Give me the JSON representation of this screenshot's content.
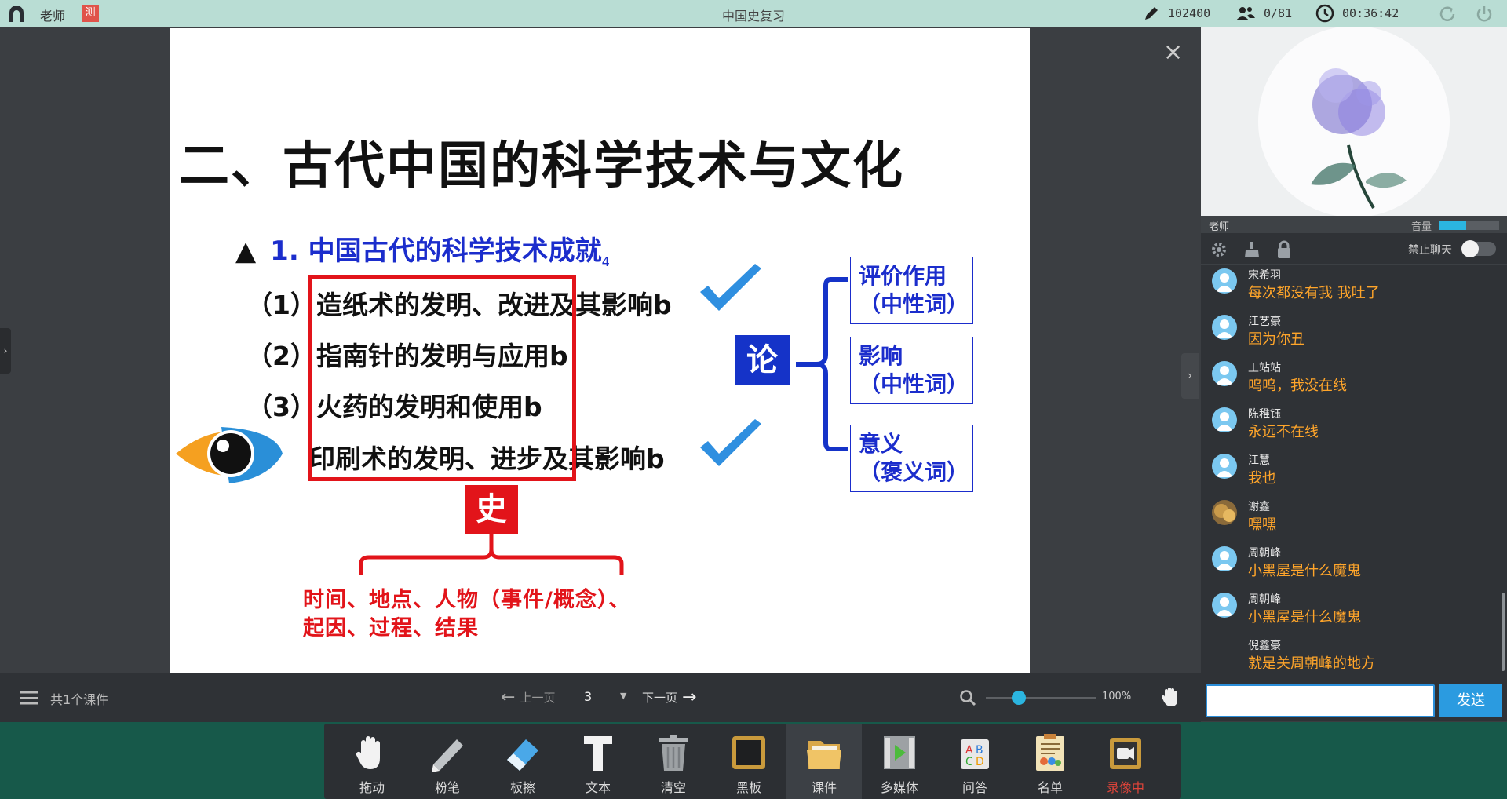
{
  "topbar": {
    "role": "老师",
    "badge": "测",
    "title": "中国史复习",
    "points": "102400",
    "online": "0/81",
    "timer": "00:36:42"
  },
  "slide": {
    "title": "二、古代中国的科学技术与文化",
    "subtitle_marker": "▲",
    "subtitle": "1. 中国古代的科学技术成就",
    "subtitle_mark": "4",
    "items": [
      "（1）造纸术的发明、改进及其影响b",
      "（2）指南针的发明与应用b",
      "（3）火药的发明和使用b",
      "印刷术的发明、进步及其影响b"
    ],
    "shi": "史",
    "shi_text_line1": "时间、地点、人物（事件/概念）、",
    "shi_text_line2": "起因、过程、结果",
    "lun": "论",
    "boxes": [
      {
        "line1": "评价作用",
        "line2": "（中性词）"
      },
      {
        "line1": "影响",
        "line2": "（中性词）"
      },
      {
        "line1": "意义",
        "line2": "（褒义词）"
      }
    ]
  },
  "video": {
    "name": "老师",
    "volume_label": "音量",
    "volume_level": 0.45
  },
  "chat": {
    "mute_label": "禁止聊天",
    "mute_on": false,
    "messages": [
      {
        "name": "宋希羽",
        "text": "每次都没有我  我吐了",
        "avatar": "default"
      },
      {
        "name": "江艺豪",
        "text": "因为你丑",
        "avatar": "default"
      },
      {
        "name": "王站站",
        "text": "呜呜，我没在线",
        "avatar": "default"
      },
      {
        "name": "陈稚钰",
        "text": "永远不在线",
        "avatar": "default"
      },
      {
        "name": "江慧",
        "text": "我也",
        "avatar": "default"
      },
      {
        "name": "谢鑫",
        "text": "嘿嘿",
        "avatar": "photo"
      },
      {
        "name": "周朝峰",
        "text": "小黑屋是什么魔鬼",
        "avatar": "default"
      },
      {
        "name": "周朝峰",
        "text": "小黑屋是什么魔鬼",
        "avatar": "default"
      },
      {
        "name": "倪鑫豪",
        "text": "就是关周朝峰的地方",
        "avatar": "none"
      }
    ],
    "input_value": "",
    "send_label": "发送"
  },
  "nav": {
    "courseware_count": "共1个课件",
    "prev_label": "上一页",
    "page": "3",
    "next_label": "下一页",
    "zoom": "100%",
    "zoom_level": 0.3
  },
  "toolbar": [
    {
      "label": "拖动",
      "icon": "hand-icon"
    },
    {
      "label": "粉笔",
      "icon": "chalk-icon"
    },
    {
      "label": "板擦",
      "icon": "eraser-icon"
    },
    {
      "label": "文本",
      "icon": "text-icon"
    },
    {
      "label": "清空",
      "icon": "trash-icon"
    },
    {
      "label": "黑板",
      "icon": "blackboard-icon"
    },
    {
      "label": "课件",
      "icon": "folder-icon",
      "active": true
    },
    {
      "label": "多媒体",
      "icon": "film-icon"
    },
    {
      "label": "问答",
      "icon": "qa-icon"
    },
    {
      "label": "名单",
      "icon": "list-icon"
    },
    {
      "label": "录像中",
      "icon": "record-icon",
      "recording": true
    }
  ],
  "colors": {
    "topbar": "#b9ddd4",
    "toolbar_bg": "#17594a",
    "accent_blue": "#2b9be0",
    "chat_text": "#ffa52a",
    "slide_red": "#e2141a",
    "slide_blue": "#1b2dcc"
  }
}
